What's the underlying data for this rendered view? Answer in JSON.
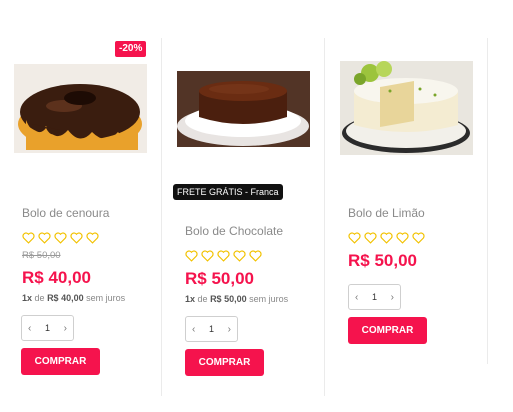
{
  "products": [
    {
      "name": "Bolo de cenoura",
      "discount_badge": "-20%",
      "rating_icon": "heart-outline-icon",
      "old_price": "R$ 50,00",
      "price": "R$ 40,00",
      "installment": {
        "count": "1x",
        "of": "de",
        "amount": "R$ 40,00",
        "suffix": "sem juros"
      },
      "quantity": "1",
      "buy_label": "COMPRAR"
    },
    {
      "name": "Bolo de Chocolate",
      "shipping_badge": "FRETE GRÁTIS - Franca",
      "rating_icon": "heart-outline-icon",
      "price": "R$ 50,00",
      "installment": {
        "count": "1x",
        "of": "de",
        "amount": "R$ 50,00",
        "suffix": "sem juros"
      },
      "quantity": "1",
      "buy_label": "COMPRAR"
    },
    {
      "name": "Bolo de Limão",
      "rating_icon": "heart-outline-icon",
      "price": "R$ 50,00",
      "quantity": "1",
      "buy_label": "COMPRAR"
    }
  ],
  "stepper": {
    "decrement_icon": "‹",
    "increment_icon": "›"
  },
  "colors": {
    "accent": "#f5134d",
    "heart": "#f2c200",
    "badge_dark": "#111111"
  }
}
